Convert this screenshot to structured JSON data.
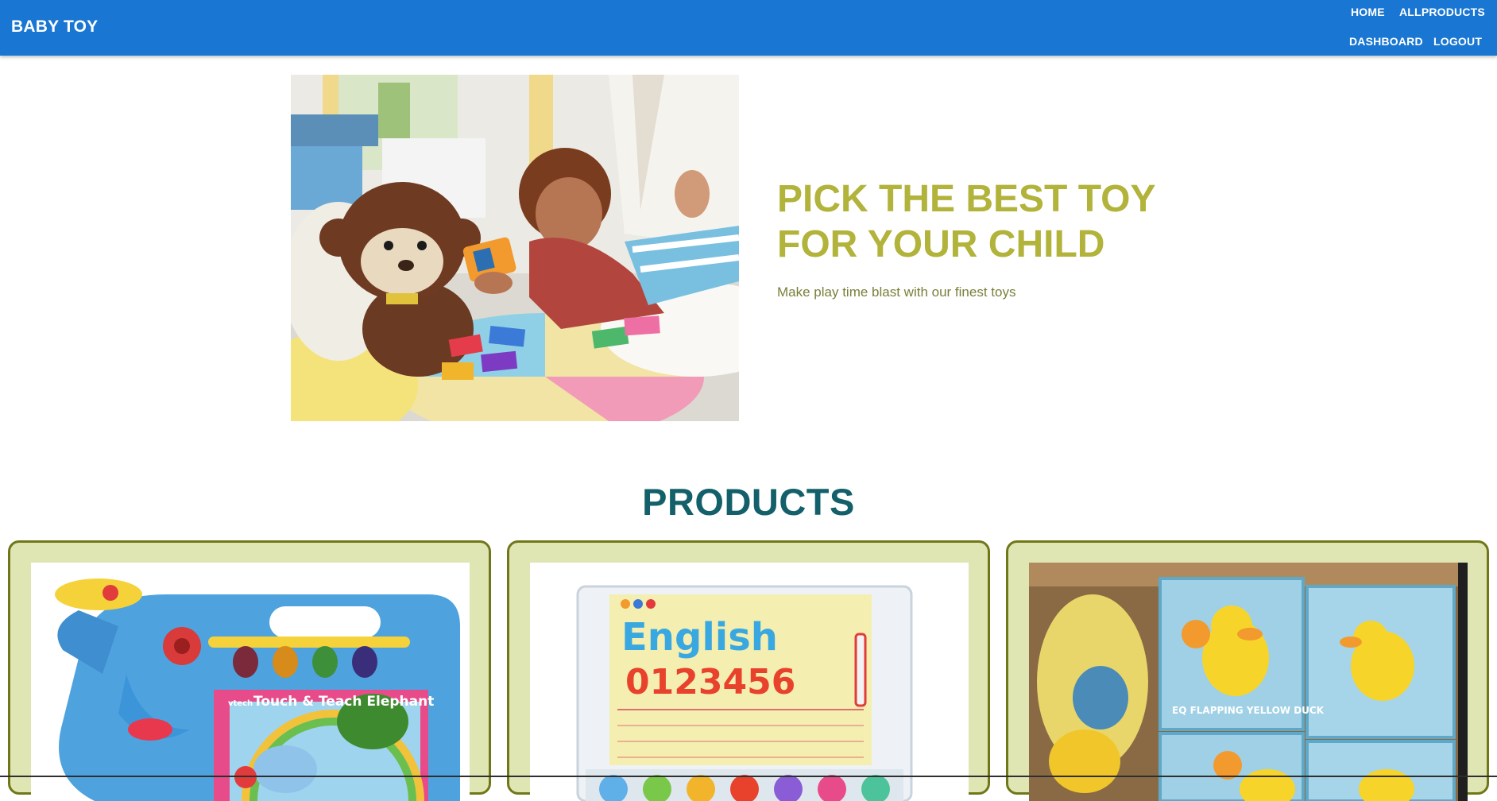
{
  "header": {
    "brand": "BABY TOY",
    "nav": {
      "home": "HOME",
      "all_products": "ALLPRODUCTS",
      "dashboard": "DASHBOARD",
      "logout": "LOGOUT"
    }
  },
  "hero": {
    "title_line1": "PICK THE BEST TOY",
    "title_line2": "FOR YOUR CHILD",
    "subtitle": "Make play time blast with our finest toys"
  },
  "products": {
    "title": "PRODUCTS",
    "card1_label": "Touch & Teach Elephant",
    "card1_brand": "vtech",
    "card2_label": "English",
    "card2_digits": "0123456",
    "card3_label": "EQ FLAPPING YELLOW DUCK"
  },
  "colors": {
    "appbar": "#1976d2",
    "hero_title": "#b2b33b",
    "products_title": "#13606a",
    "card_bg": "#e0e5b4",
    "card_border": "#707718"
  }
}
